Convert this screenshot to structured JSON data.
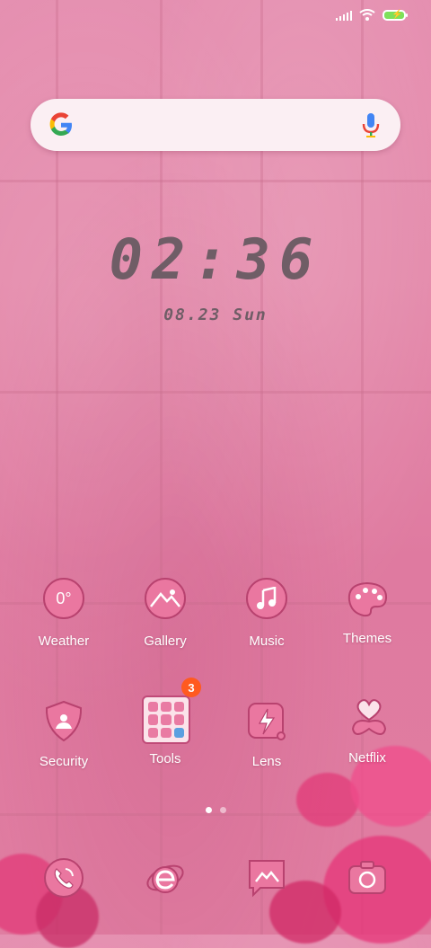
{
  "status_bar": {
    "signal_icon": "cellular-signal-icon",
    "wifi_icon": "wifi-icon",
    "battery_icon": "battery-charging-icon",
    "battery_color": "#7ee05a"
  },
  "search": {
    "logo_icon": "google-g-icon",
    "mic_icon": "microphone-icon"
  },
  "clock": {
    "time": "02:36",
    "date": "08.23 Sun"
  },
  "apps_row1": [
    {
      "label": "Weather",
      "icon": "weather-icon",
      "value": "0°"
    },
    {
      "label": "Gallery",
      "icon": "gallery-icon"
    },
    {
      "label": "Music",
      "icon": "music-note-icon"
    },
    {
      "label": "Themes",
      "icon": "palette-icon"
    }
  ],
  "apps_row2": [
    {
      "label": "Security",
      "icon": "shield-icon"
    },
    {
      "label": "Tools",
      "icon": "tools-folder-icon",
      "badge": "3"
    },
    {
      "label": "Lens",
      "icon": "lens-icon"
    },
    {
      "label": "Netflix",
      "icon": "heart-clover-icon"
    }
  ],
  "page_indicator": {
    "pages": 2,
    "active": 1
  },
  "dock": [
    {
      "icon": "phone-icon"
    },
    {
      "icon": "browser-icon"
    },
    {
      "icon": "messages-icon"
    },
    {
      "icon": "camera-icon"
    }
  ],
  "colors": {
    "accent_pink": "#ea77a0",
    "outline": "#b8426f",
    "badge": "#ff5a1f",
    "clock_text": "#6f5d66"
  }
}
